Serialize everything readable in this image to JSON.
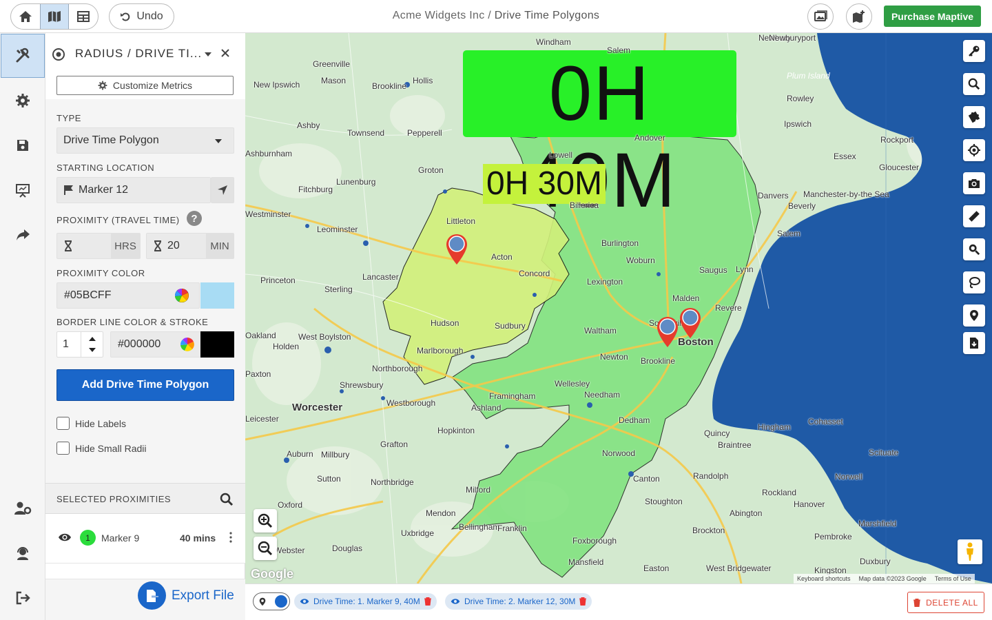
{
  "header": {
    "title_org": "Acme Widgets Inc /",
    "title_page": "Drive Time Polygons",
    "undo_label": "Undo",
    "purchase_label": "Purchase Maptive"
  },
  "panel": {
    "title": "RADIUS / DRIVE TI...",
    "customize_label": "Customize Metrics",
    "type_label": "TYPE",
    "type_value": "Drive Time Polygon",
    "start_label": "STARTING LOCATION",
    "start_value": "Marker 12",
    "proximity_label": "PROXIMITY (TRAVEL TIME)",
    "hrs_value": "",
    "hrs_unit": "HRS",
    "min_value": "20",
    "min_unit": "MIN",
    "color_label": "PROXIMITY COLOR",
    "color_value": "#05BCFF",
    "color_swatch": "#a8dcf4",
    "border_label": "BORDER LINE COLOR & STROKE",
    "stroke_value": "1",
    "border_color_value": "#000000",
    "border_swatch": "#000000",
    "add_label": "Add Drive Time Polygon",
    "hide_labels": "Hide Labels",
    "hide_small": "Hide Small Radii",
    "selected_label": "SELECTED PROXIMITIES",
    "selected_items": [
      {
        "index": "1",
        "name": "Marker 9",
        "value": "40 mins"
      }
    ],
    "export_label": "Export File"
  },
  "map": {
    "label_40": "0H 40M",
    "label_30": "0H 30M",
    "attribution_keys": "Keyboard shortcuts",
    "attribution_data": "Map data ©2023 Google",
    "attribution_terms": "Terms of Use",
    "google": "Google",
    "places": [
      {
        "name": "Windham"
      },
      {
        "name": "Salem"
      },
      {
        "name": "Newbury"
      },
      {
        "name": "Newburyport"
      },
      {
        "name": "Greenville"
      },
      {
        "name": "Mason"
      },
      {
        "name": "Hollis"
      },
      {
        "name": "New Ipswich"
      },
      {
        "name": "Brookline"
      },
      {
        "name": "Plum Island"
      },
      {
        "name": "Rowley"
      },
      {
        "name": "Ipswich"
      },
      {
        "name": "Ashby"
      },
      {
        "name": "Townsend"
      },
      {
        "name": "Pepperell"
      },
      {
        "name": "Andover"
      },
      {
        "name": "Lowell"
      },
      {
        "name": "Rockport"
      },
      {
        "name": "Essex"
      },
      {
        "name": "Gloucester"
      },
      {
        "name": "Ashburnham"
      },
      {
        "name": "Groton"
      },
      {
        "name": "Lunenburg"
      },
      {
        "name": "Fitchburg"
      },
      {
        "name": "Danvers"
      },
      {
        "name": "Manchester-by-the Sea"
      },
      {
        "name": "Beverly"
      },
      {
        "name": "Westminster"
      },
      {
        "name": "Leominster"
      },
      {
        "name": "Littleton"
      },
      {
        "name": "Billerica"
      },
      {
        "name": "Salem"
      },
      {
        "name": "Burlington"
      },
      {
        "name": "Acton"
      },
      {
        "name": "Woburn"
      },
      {
        "name": "Lancaster"
      },
      {
        "name": "Concord"
      },
      {
        "name": "Saugus"
      },
      {
        "name": "Lynn"
      },
      {
        "name": "Princeton"
      },
      {
        "name": "Sterling"
      },
      {
        "name": "Lexington"
      },
      {
        "name": "Malden"
      },
      {
        "name": "Revere"
      },
      {
        "name": "Hudson"
      },
      {
        "name": "Sudbury"
      },
      {
        "name": "Waltham"
      },
      {
        "name": "Oakland"
      },
      {
        "name": "West Boylston"
      },
      {
        "name": "Holden"
      },
      {
        "name": "Marlborough"
      },
      {
        "name": "Somerville"
      },
      {
        "name": "Boston"
      },
      {
        "name": "Newton"
      },
      {
        "name": "Brookline"
      },
      {
        "name": "Paxton"
      },
      {
        "name": "Northborough"
      },
      {
        "name": "Wellesley"
      },
      {
        "name": "Shrewsbury"
      },
      {
        "name": "Needham"
      },
      {
        "name": "Framingham"
      },
      {
        "name": "Westborough"
      },
      {
        "name": "Worcester"
      },
      {
        "name": "Ashland"
      },
      {
        "name": "Dedham"
      },
      {
        "name": "Quincy"
      },
      {
        "name": "Hingham"
      },
      {
        "name": "Cohasset"
      },
      {
        "name": "Leicester"
      },
      {
        "name": "Hopkinton"
      },
      {
        "name": "Auburn"
      },
      {
        "name": "Millbury"
      },
      {
        "name": "Grafton"
      },
      {
        "name": "Norwood"
      },
      {
        "name": "Braintree"
      },
      {
        "name": "Scituate"
      },
      {
        "name": "Canton"
      },
      {
        "name": "Randolph"
      },
      {
        "name": "Norwell"
      },
      {
        "name": "Sutton"
      },
      {
        "name": "Northbridge"
      },
      {
        "name": "Milford"
      },
      {
        "name": "Stoughton"
      },
      {
        "name": "Rockland"
      },
      {
        "name": "Hanover"
      },
      {
        "name": "Oxford"
      },
      {
        "name": "Mendon"
      },
      {
        "name": "Abington"
      },
      {
        "name": "Marshfield"
      },
      {
        "name": "Bellingham"
      },
      {
        "name": "Franklin"
      },
      {
        "name": "Uxbridge"
      },
      {
        "name": "Brockton"
      },
      {
        "name": "Douglas"
      },
      {
        "name": "Foxborough"
      },
      {
        "name": "Webster"
      },
      {
        "name": "Pembroke"
      },
      {
        "name": "Mansfield"
      },
      {
        "name": "Easton"
      },
      {
        "name": "West Bridgewater"
      },
      {
        "name": "Kingston"
      },
      {
        "name": "Duxbury"
      }
    ]
  },
  "bottom": {
    "chip1": "Drive Time: 1. Marker 9, 40M",
    "chip2": "Drive Time: 2. Marker 12, 30M",
    "delete_all": "DELETE ALL"
  },
  "colors": {
    "accent": "#1a66c9",
    "purchase": "#2f9e44",
    "ring40": "#28f028",
    "ring30": "#c4f23c",
    "danger": "#dd4433"
  },
  "icons": {
    "home": "home-icon",
    "map": "map-icon",
    "table": "table-icon",
    "undo": "undo-icon",
    "tools": "tools-icon",
    "settings": "gear-icon",
    "save": "floppy-icon",
    "present": "presentation-icon",
    "share": "share-icon",
    "users": "user-gear-icon",
    "support": "headset-icon",
    "logout": "logout-icon"
  }
}
